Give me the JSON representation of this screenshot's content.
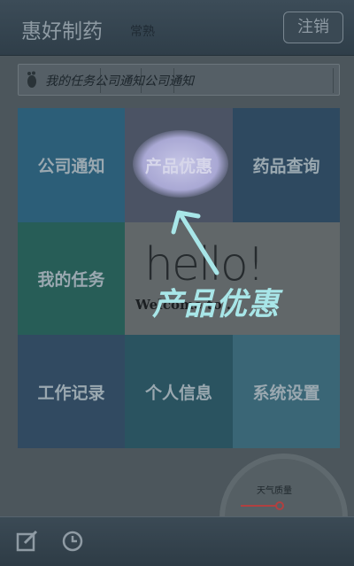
{
  "header": {
    "app_title": "惠好制药",
    "city": "常熟",
    "logout_label": "注销"
  },
  "ticker": {
    "segments": [
      "我的任务",
      "公司通知",
      "公司通知"
    ]
  },
  "tiles": {
    "notice": "公司通知",
    "promo": "产品优惠",
    "drug": "药品查询",
    "task": "我的任务",
    "work": "工作记录",
    "profile": "个人信息",
    "settings": "系统设置"
  },
  "banner": {
    "hello": "hello!",
    "welcome": "Welcome to ..."
  },
  "annotation": {
    "label": "产品优惠",
    "color": "#a8e6e8"
  },
  "weather_widget": {
    "label": "天气质量"
  },
  "footer": {
    "icons": [
      "edit-icon",
      "clock-icon"
    ]
  }
}
